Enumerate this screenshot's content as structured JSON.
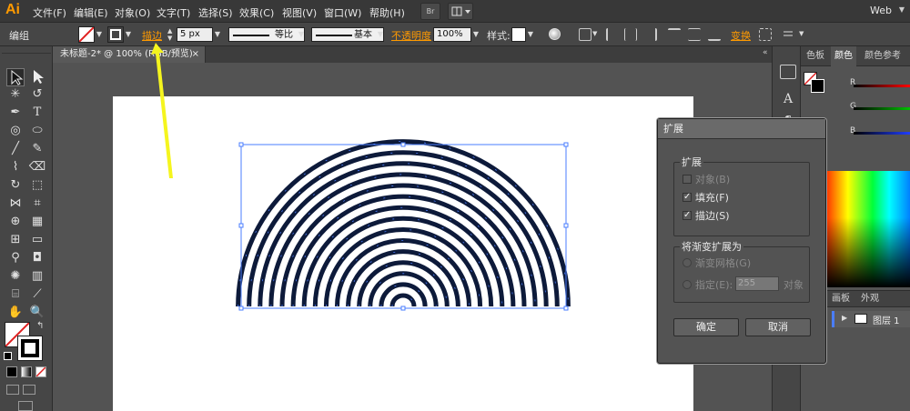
{
  "app": {
    "logo": "Ai",
    "workspace": "Web"
  },
  "menu": [
    "文件(F)",
    "编辑(E)",
    "对象(O)",
    "文字(T)",
    "选择(S)",
    "效果(C)",
    "视图(V)",
    "窗口(W)",
    "帮助(H)"
  ],
  "menubar_button_label": "Br",
  "control_bar": {
    "selection_label": "编组",
    "stroke_label": "描边",
    "stroke_weight": "5 px",
    "profile_label": "等比",
    "brush_label": "基本",
    "opacity_label": "不透明度",
    "opacity_value": "100%",
    "style_label": "样式:",
    "transform_label": "变换"
  },
  "document_tab": {
    "title": "未标题-2* @ 100% (RGB/预览)",
    "close": "×"
  },
  "right_panel": {
    "color_tabs": [
      "色板",
      "颜色",
      "颜色参考"
    ],
    "sliders": [
      {
        "letter": "R",
        "color": "#ff0000"
      },
      {
        "letter": "G",
        "color": "#00c000"
      },
      {
        "letter": "B",
        "color": "#1f3dff"
      }
    ],
    "layers_tabs": [
      "画板",
      "外观"
    ],
    "layer_name": "图层 1"
  },
  "expand_dialog": {
    "title": "扩展",
    "expand_group_title": "扩展",
    "object_label": "对象(B)",
    "fill_label": "填充(F)",
    "stroke_label": "描边(S)",
    "gradient_group_title": "将渐变扩展为",
    "gradient_mesh_label": "渐变网格(G)",
    "specify_label": "指定(E):",
    "specify_value": "255",
    "object_suffix": "对象",
    "ok_label": "确定",
    "cancel_label": "取消"
  },
  "colors": {
    "accent_orange": "#ff9a00",
    "arrow_yellow": "#f5f51e",
    "art_stroke": "#0d1a3a",
    "selection_blue": "#4a7dff"
  }
}
